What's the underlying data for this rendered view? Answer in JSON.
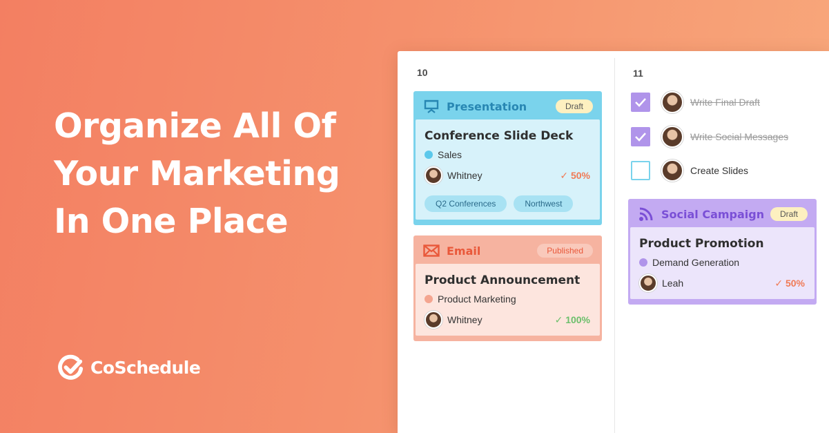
{
  "hero": {
    "headline_line1": "Organize All Of",
    "headline_line2": "Your Marketing",
    "headline_line3": "In One Place"
  },
  "brand": {
    "name": "CoSchedule",
    "logo_icon": "check-circle-icon"
  },
  "calendar": {
    "day1": {
      "number": "10",
      "cards": [
        {
          "type_label": "Presentation",
          "type_icon": "presentation-icon",
          "status": "Draft",
          "title": "Conference Slide Deck",
          "category": "Sales",
          "owner": "Whitney",
          "progress": "50%",
          "tags": [
            "Q2 Conferences",
            "Northwest"
          ],
          "colors": {
            "frame": "#7ad3ec",
            "body": "#d7f2fa",
            "accent": "#2887b3",
            "dot": "#5bc8eb",
            "progress": "#f07a55"
          }
        },
        {
          "type_label": "Email",
          "type_icon": "envelope-icon",
          "status": "Published",
          "title": "Product Announcement",
          "category": "Product Marketing",
          "owner": "Whitney",
          "progress": "100%",
          "colors": {
            "frame": "#f6b3a0",
            "body": "#fde5de",
            "accent": "#e9583a",
            "dot": "#f4a590",
            "progress": "#6bbf6b"
          }
        }
      ]
    },
    "day2": {
      "number": "11",
      "tasks": [
        {
          "label": "Write Final Draft",
          "done": true
        },
        {
          "label": "Write Social Messages",
          "done": true
        },
        {
          "label": "Create Slides",
          "done": false
        }
      ],
      "cards": [
        {
          "type_label": "Social Campaign",
          "type_icon": "rss-icon",
          "status": "Draft",
          "title": "Product Promotion",
          "category": "Demand Generation",
          "owner": "Leah",
          "progress": "50%",
          "colors": {
            "frame": "#c3aaf2",
            "body": "#ece5fb",
            "accent": "#7a4fd6",
            "dot": "#b094ea",
            "progress": "#f07a55"
          }
        }
      ]
    }
  }
}
